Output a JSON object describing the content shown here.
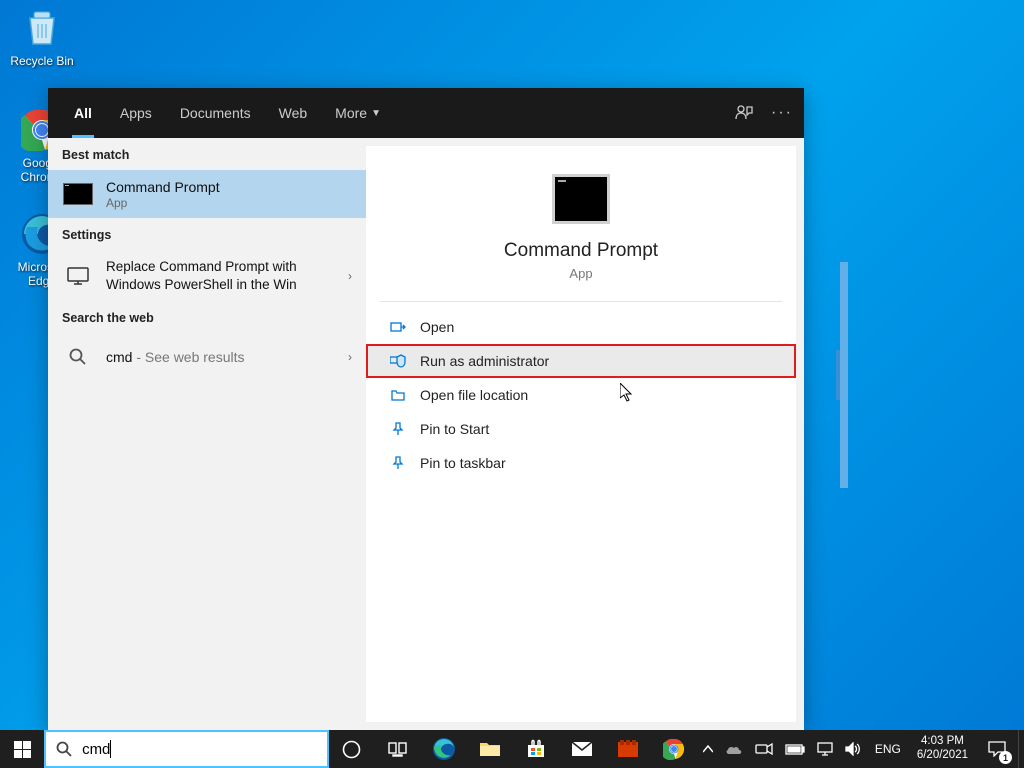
{
  "desktop": {
    "recycle_bin": "Recycle Bin",
    "chrome": "Google Chrome",
    "edge": "Microsoft Edge"
  },
  "search": {
    "tabs": {
      "all": "All",
      "apps": "Apps",
      "documents": "Documents",
      "web": "Web",
      "more": "More"
    },
    "sections": {
      "best_match": "Best match",
      "settings": "Settings",
      "search_web": "Search the web"
    },
    "best_match_item": {
      "title": "Command Prompt",
      "sub": "App"
    },
    "settings_item": {
      "title": "Replace Command Prompt with Windows PowerShell in the Win"
    },
    "web_item": {
      "prefix": "cmd",
      "suffix": " - See web results"
    },
    "preview": {
      "title": "Command Prompt",
      "sub": "App"
    },
    "actions": {
      "open": "Open",
      "run_admin": "Run as administrator",
      "open_location": "Open file location",
      "pin_start": "Pin to Start",
      "pin_taskbar": "Pin to taskbar"
    },
    "query": "cmd"
  },
  "taskbar": {
    "lang": "ENG",
    "time": "4:03 PM",
    "date": "6/20/2021",
    "notif_count": "1"
  }
}
